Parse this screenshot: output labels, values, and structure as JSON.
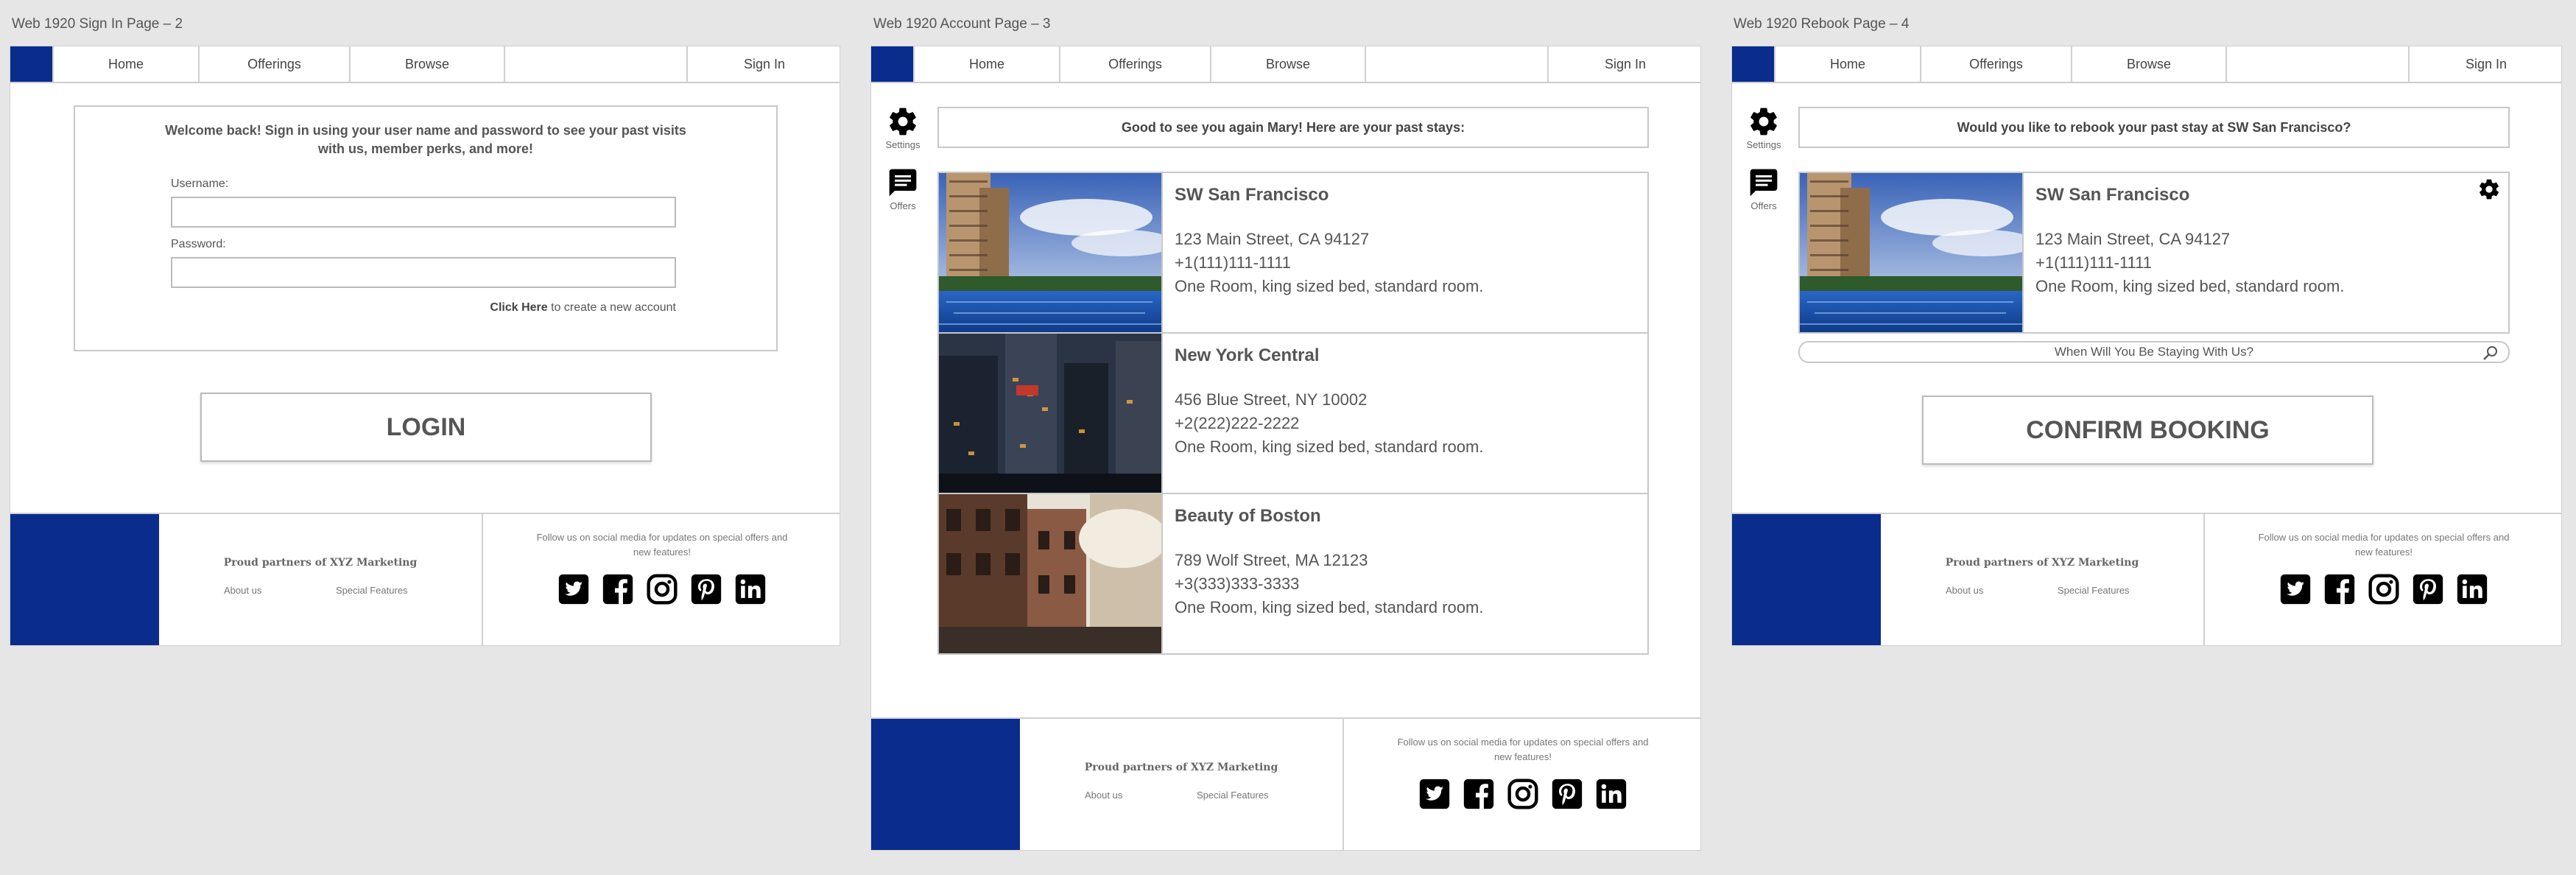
{
  "artboards": [
    {
      "title": "Web 1920 Sign In Page – 2"
    },
    {
      "title": "Web 1920 Account Page – 3"
    },
    {
      "title": "Web 1920 Rebook Page – 4"
    }
  ],
  "nav": {
    "home": "Home",
    "offerings": "Offerings",
    "browse": "Browse",
    "signin": "Sign In"
  },
  "sidebar": {
    "settings": "Settings",
    "offers": "Offers"
  },
  "footer": {
    "partners": "Proud partners of XYZ Marketing",
    "about": "About us",
    "special": "Special Features",
    "follow": "Follow us on social media for updates on special offers and new features!"
  },
  "signin": {
    "welcome": "Welcome back! Sign in using your user name and password to see your past visits with us, member perks, and more!",
    "username_label": "Username:",
    "password_label": "Password:",
    "click_here": "Click Here",
    "create_account": " to create a new account",
    "login": "LOGIN"
  },
  "account": {
    "greeting": "Good to see you again Mary! Here are your past stays:",
    "stays": [
      {
        "name": "SW San Francisco",
        "address": "123 Main Street, CA 94127",
        "phone": "+1(111)111-1111",
        "room": "One Room, king sized bed, standard room."
      },
      {
        "name": "New York Central",
        "address": "456 Blue Street, NY 10002",
        "phone": "+2(222)222-2222",
        "room": "One Room, king sized bed, standard room."
      },
      {
        "name": "Beauty of Boston",
        "address": "789 Wolf Street, MA 12123",
        "phone": "+3(333)333-3333",
        "room": "One Room, king sized bed, standard room."
      }
    ]
  },
  "rebook": {
    "question": "Would you like to rebook your past stay at SW San Francisco?",
    "stay": {
      "name": "SW San Francisco",
      "address": "123 Main Street, CA 94127",
      "phone": "+1(111)111-1111",
      "room": "One Room, king sized bed, standard room."
    },
    "date_placeholder": "When Will You Be Staying With Us?",
    "confirm": "CONFIRM BOOKING"
  },
  "colors": {
    "brand": "#0a2c8c"
  }
}
